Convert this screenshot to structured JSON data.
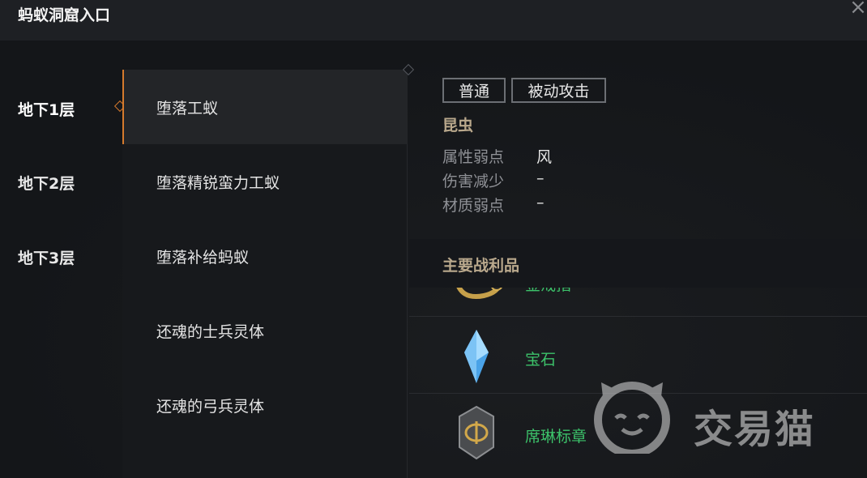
{
  "window": {
    "title": "蚂蚁洞窟入口",
    "close_icon": "close-icon"
  },
  "floors": [
    {
      "label": "地下1层",
      "selected": true
    },
    {
      "label": "地下2层",
      "selected": false
    },
    {
      "label": "地下3层",
      "selected": false
    }
  ],
  "monsters": [
    {
      "name": "堕落工蚁",
      "selected": true
    },
    {
      "name": "堕落精锐蛮力工蚁",
      "selected": false
    },
    {
      "name": "堕落补给蚂蚁",
      "selected": false
    },
    {
      "name": "还魂的士兵灵体",
      "selected": false
    },
    {
      "name": "还魂的弓兵灵体",
      "selected": false
    }
  ],
  "details": {
    "tags": [
      "普通",
      "被动攻击"
    ],
    "category": "昆虫",
    "attributes": [
      {
        "label": "属性弱点",
        "value": "风"
      },
      {
        "label": "伤害减少",
        "value": "–"
      },
      {
        "label": "材质弱点",
        "value": "–"
      }
    ],
    "loot_title": "主要战利品",
    "loot": [
      {
        "name": "金戒指",
        "icon": "gold-ring-icon"
      },
      {
        "name": "宝石",
        "icon": "blue-gem-icon"
      },
      {
        "name": "席琳标章",
        "icon": "emblem-icon"
      }
    ]
  },
  "watermark": {
    "text": "交易猫",
    "icon": "cat-logo-icon"
  },
  "colors": {
    "accent": "#d57a2c",
    "loot_green": "#3cc26a",
    "category_gold": "#b9a88c"
  }
}
